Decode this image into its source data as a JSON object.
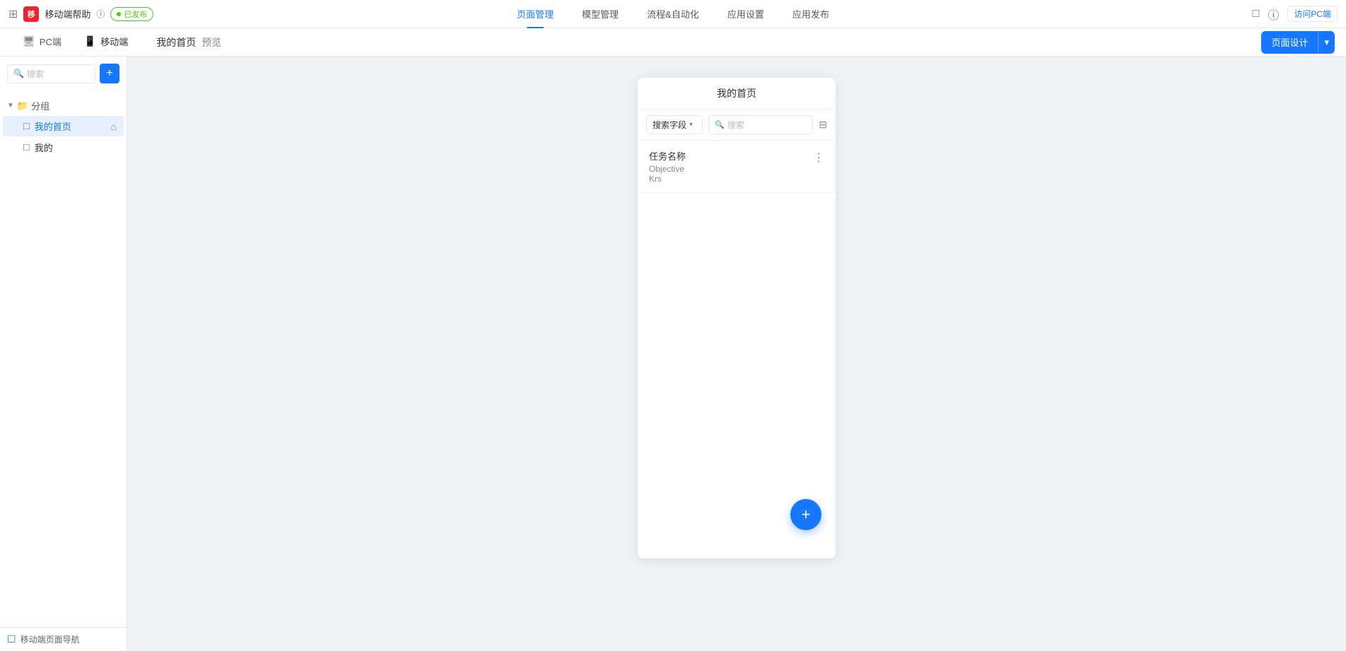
{
  "topNav": {
    "appGridIcon": "⊞",
    "appLogoText": "移",
    "appName": "移动端帮助",
    "helpLabel": "移动端帮助",
    "helpIcon": "ⓘ",
    "publishedLabel": "已发布",
    "navItems": [
      {
        "label": "页面管理",
        "active": true
      },
      {
        "label": "模型管理",
        "active": false
      },
      {
        "label": "流程&自动化",
        "active": false
      },
      {
        "label": "应用设置",
        "active": false
      },
      {
        "label": "应用发布",
        "active": false
      }
    ],
    "rightIcons": [
      "□",
      "ⓘ"
    ],
    "visitPcLabel": "访问PC端"
  },
  "subHeader": {
    "tabs": [
      {
        "label": "PC端",
        "icon": "☐",
        "active": false
      },
      {
        "label": "移动端",
        "icon": "📱",
        "active": true
      }
    ],
    "breadcrumb": "我的首页",
    "breadcrumbSuffix": "预览",
    "pageDesignLabel": "页面设计",
    "pageDesignArrow": "▾"
  },
  "sidebar": {
    "searchPlaceholder": "搜索",
    "searchIcon": "🔍",
    "addIcon": "+",
    "groupLabel": "分组",
    "folderIcon": "📁",
    "items": [
      {
        "label": "我的首页",
        "icon": "☐",
        "active": true,
        "homeIcon": "⌂"
      },
      {
        "label": "我的",
        "icon": "☐",
        "active": false
      }
    ],
    "bottomLabel": "移动端页面导航",
    "bottomIcon": "☐"
  },
  "preview": {
    "title": "我的首页",
    "searchFieldLabel": "搜索字段",
    "searchFieldArrow": "▾",
    "searchPlaceholder": "搜索",
    "filterIcon": "⊟",
    "listItems": [
      {
        "title": "任务名称",
        "sub1": "Objective",
        "sub2": "Krs",
        "hasMenu": true
      }
    ],
    "fabIcon": "+"
  }
}
